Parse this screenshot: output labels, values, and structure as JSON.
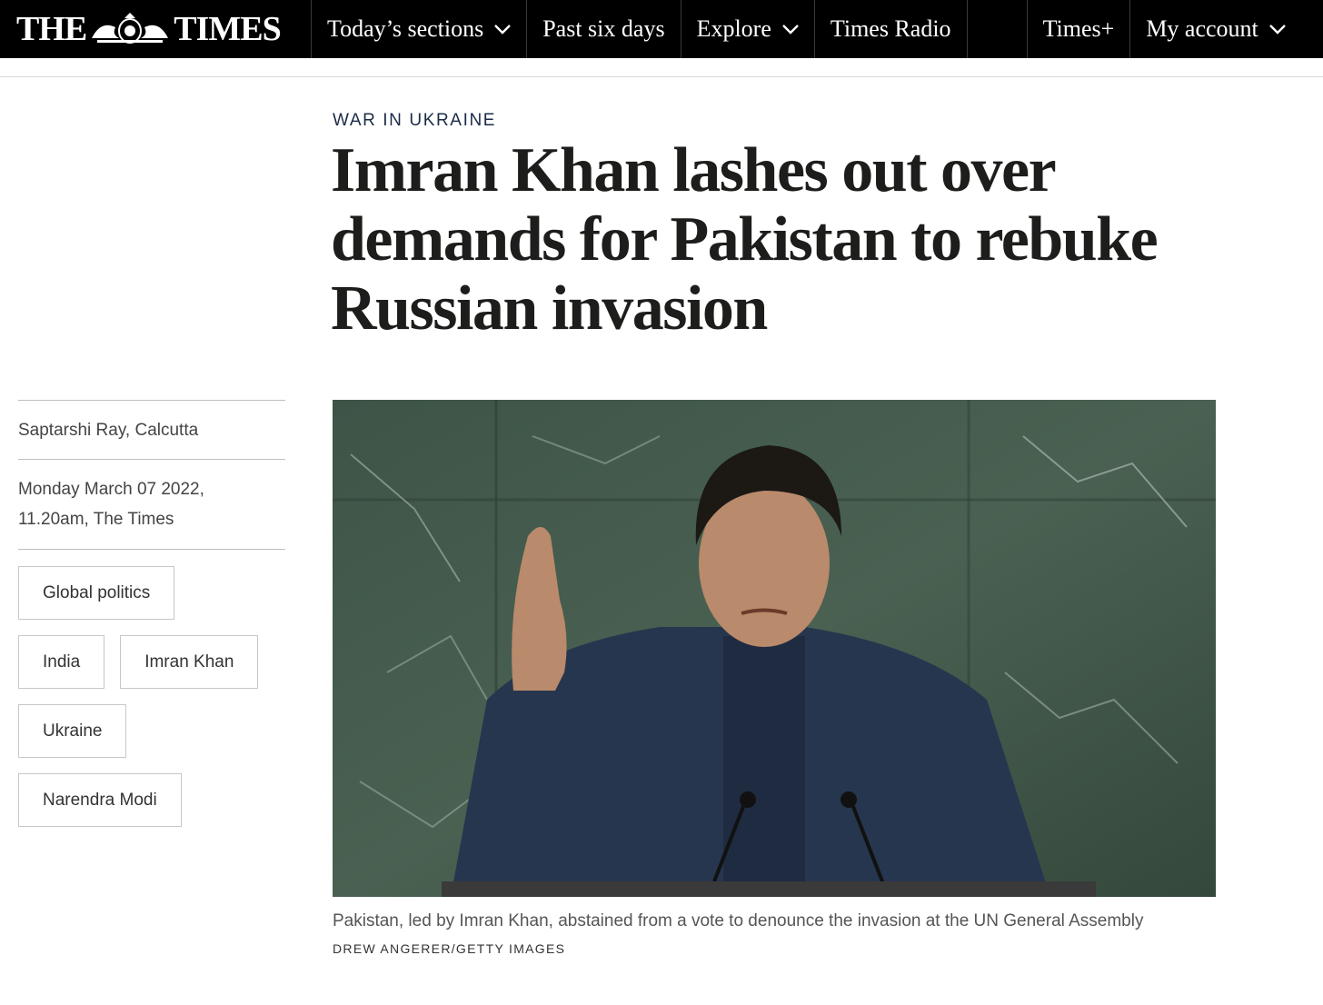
{
  "nav": {
    "brand_left": "THE",
    "brand_right": "TIMES",
    "items": [
      {
        "label": "Today’s sections",
        "has_dropdown": true
      },
      {
        "label": "Past six days",
        "has_dropdown": false
      },
      {
        "label": "Explore",
        "has_dropdown": true
      },
      {
        "label": "Times Radio",
        "has_dropdown": false
      }
    ],
    "right_items": [
      {
        "label": "Times+",
        "has_dropdown": false
      },
      {
        "label": "My account",
        "has_dropdown": true
      }
    ]
  },
  "article": {
    "kicker": "WAR IN UKRAINE",
    "headline": "Imran Khan lashes out over demands for Pakistan to rebuke Russian invasion",
    "byline": "Saptarshi Ray, Calcutta",
    "date_line1": "Monday March 07 2022,",
    "date_line2": "11.20am, The Times",
    "tags": [
      "Global politics",
      "India",
      "Imran Khan",
      "Ukraine",
      "Narendra Modi"
    ],
    "caption": "Pakistan, led by Imran Khan, abstained from a vote to denounce the invasion at the UN General Assembly",
    "credit": "DREW ANGERER/GETTY IMAGES"
  },
  "colors": {
    "nav_bg": "#000000",
    "kicker": "#1b2c48",
    "photo_marble": "#3f5448"
  }
}
